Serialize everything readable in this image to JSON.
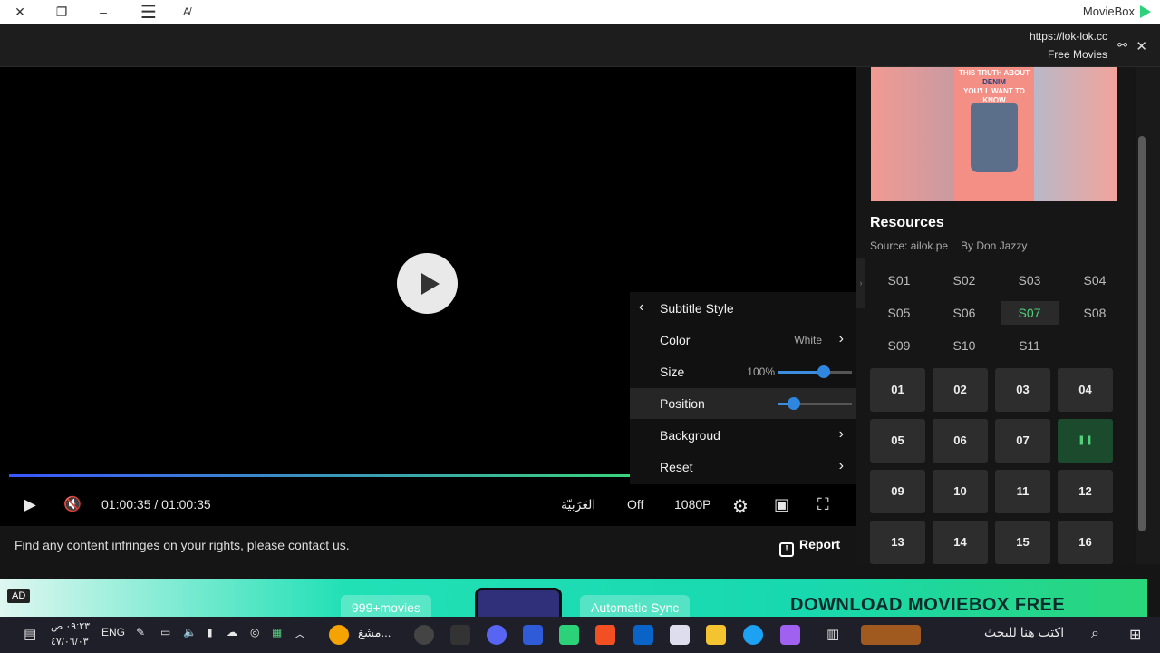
{
  "titlebar": {
    "app_name": "MovieBox"
  },
  "urlbar": {
    "url": "https://lok-lok.cc",
    "site_title": "Free Movies"
  },
  "player": {
    "time": "01:00:35 / 01:00:35",
    "progress": 1.0,
    "language": "العَرَبيّة",
    "subtitle_state": "Off",
    "quality": "1080P"
  },
  "subtitle_menu": {
    "title": "Subtitle Style",
    "color_label": "Color",
    "color_value": "White",
    "size_label": "Size",
    "size_value": "100%",
    "size_level": 0.62,
    "position_label": "Position",
    "position_level": 0.22,
    "background_label": "Backgroud",
    "reset_label": "Reset"
  },
  "notice": {
    "text": "Find any content infringes on your rights, please contact us.",
    "report_label": "Report"
  },
  "resources": {
    "poster_text_1": "THIS TRUTH ABOUT",
    "poster_text_2": "DENIM",
    "poster_text_3": "YOU'LL WANT TO KNOW",
    "title": "Resources",
    "source": "Source: ailok.pe",
    "by": "By Don Jazzy",
    "seasons": [
      "S01",
      "S02",
      "S03",
      "S04",
      "S05",
      "S06",
      "S07",
      "S08",
      "S09",
      "S10",
      "S11"
    ],
    "active_season": "S07",
    "episodes": [
      "01",
      "02",
      "03",
      "04",
      "05",
      "06",
      "07",
      "",
      "09",
      "10",
      "11",
      "12",
      "13",
      "14",
      "15",
      "16"
    ],
    "playing_episode": "08"
  },
  "ad": {
    "tag": "AD",
    "pill_1": "999+movies",
    "pill_2": "Automatic Sync",
    "cta": "DOWNLOAD MOVIEBOX FREE"
  },
  "taskbar": {
    "search_placeholder": "اكتب هنا للبحث",
    "lang": "ENG",
    "time": "٠٩:٢٣ ص",
    "date": "٤٧/٠٦/٠٣",
    "app_label": "مشغ..."
  }
}
